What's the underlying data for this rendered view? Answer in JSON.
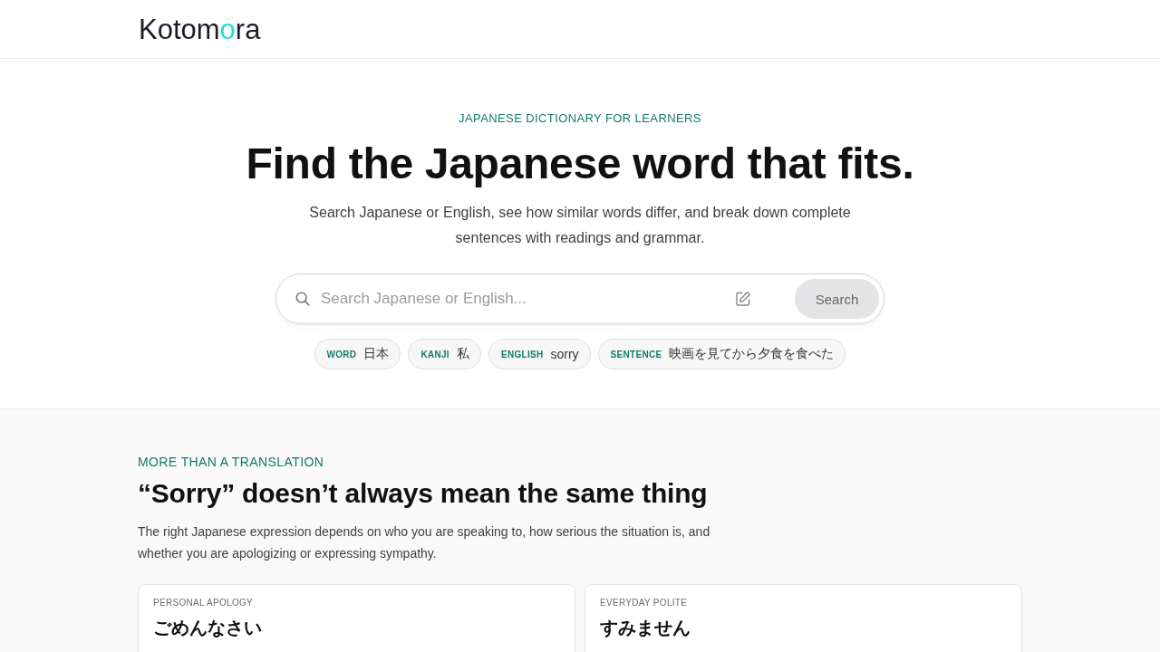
{
  "header": {
    "logo": [
      {
        "text": "Kotom",
        "accent": false
      },
      {
        "text": "o",
        "accent": true
      },
      {
        "text": "ra",
        "accent": false
      }
    ]
  },
  "hero": {
    "eyebrow": "JAPANESE DICTIONARY FOR LEARNERS",
    "title": "Find the Japanese word that fits.",
    "subtitle": "Search Japanese or English, see how similar words differ, and break down complete sentences with readings and grammar.",
    "search": {
      "placeholder": "Search Japanese or English...",
      "button": "Search"
    },
    "examples": [
      {
        "label": "WORD",
        "text": "日本"
      },
      {
        "label": "KANJI",
        "text": "私"
      },
      {
        "label": "ENGLISH",
        "text": "sorry"
      },
      {
        "label": "SENTENCE",
        "text": "映画を見てから夕食を食べた"
      }
    ]
  },
  "section": {
    "eyebrow": "MORE THAN A TRANSLATION",
    "title": "“Sorry” doesn’t always mean the same thing",
    "description": "The right Japanese expression depends on who you are speaking to, how serious the situation is, and whether you are apologizing or expressing sympathy.",
    "cards": [
      {
        "label": "PERSONAL APOLOGY",
        "title": "ごめんなさい"
      },
      {
        "label": "EVERYDAY POLITE",
        "title": "すみません"
      }
    ]
  }
}
